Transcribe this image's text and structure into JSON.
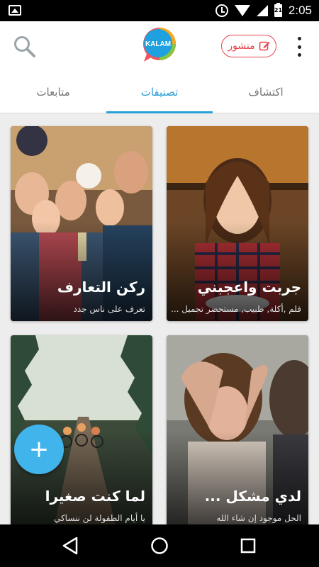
{
  "status_bar": {
    "time": "2:05",
    "battery_level": "21",
    "icons": [
      "image-icon",
      "alarm-icon",
      "wifi-icon",
      "signal-icon",
      "battery-icon"
    ]
  },
  "app_bar": {
    "logo_text": "KALAM",
    "post_button_label": "منشور",
    "accent_color": "#e8424c"
  },
  "tabs": [
    {
      "label": "متابعات",
      "active": false
    },
    {
      "label": "تصنيفات",
      "active": true
    },
    {
      "label": "اكتشاف",
      "active": false
    }
  ],
  "tab_active_color": "#2a9fd8",
  "cards": [
    {
      "title": "جربت واعجبني",
      "subtitle": "فلم ,أكلة, طبيب, مستحضر تجميل ..."
    },
    {
      "title": "ركن التعارف",
      "subtitle": "تعرف على ناس جدد"
    },
    {
      "title": "لدي مشكل ...",
      "subtitle": "الحل موجود إن شاء الله"
    },
    {
      "title": "لما كنت صغيرا",
      "subtitle": "يا أيام الطفولة لن ننساكي"
    }
  ],
  "fab_label": "+",
  "fab_color": "#42b4ec"
}
